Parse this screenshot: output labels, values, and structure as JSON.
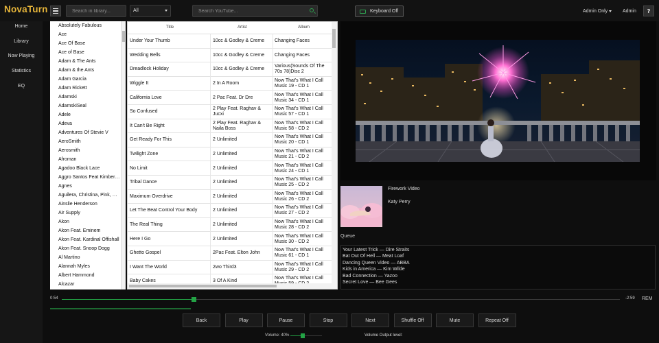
{
  "app": {
    "brand": "NovaTurn"
  },
  "topbar": {
    "library_search_placeholder": "Search in library...",
    "filter_value": "All",
    "youtube_search_placeholder": "Search YouTube...",
    "keyboard_label": "Keyboard Off",
    "admin_only_label": "Admin Only",
    "admin_label": "Admin",
    "help_label": "?"
  },
  "nav": [
    {
      "label": "Home"
    },
    {
      "label": "Library"
    },
    {
      "label": "Now Playing"
    },
    {
      "label": "Statistics"
    },
    {
      "label": "EQ"
    }
  ],
  "artists": [
    "Absolutely Fabulous",
    "Ace",
    "Ace Of Base",
    "Ace of Base",
    "Adam & The Ants",
    "Adam & the Ants",
    "Adam Garcia",
    "Adam Rickett",
    "Adamski",
    "AdamskiSeal",
    "Adele",
    "Adeva",
    "Adventures Of Stevie V",
    "AeroSmith",
    "Aerosmith",
    "Afroman",
    "Agadoo Black Lace",
    "Aggro Santos Feat Kimberly Wyatt",
    "Agnes",
    "Aguilera, Christina, Pink, Mya",
    "Ainslie Henderson",
    "Air Supply",
    "Akon",
    "Akon Feat. Eminem",
    "Akon Feat. Kardinal Offishall",
    "Akon Feat. Snoop Dogg",
    "Al Martino",
    "Alannah Myles",
    "Albert Hammond",
    "Alcazar"
  ],
  "tracks": {
    "columns": {
      "title": "Title",
      "artist": "Artist",
      "album": "Album"
    },
    "rows": [
      {
        "title": "Under Your Thumb",
        "artist": "10cc & Godley & Creme",
        "album": "Changing Faces"
      },
      {
        "title": "Wedding Bells",
        "artist": "10cc & Godley & Creme",
        "album": "Changing Faces"
      },
      {
        "title": "Dreadlock Holiday",
        "artist": "10cc & Godley & Creme",
        "album": "Various(Sounds Of The 70s 78)Disc 2"
      },
      {
        "title": "Wiggle It",
        "artist": "2 In A Room",
        "album": "Now That's What I Call Music 19 - CD 1"
      },
      {
        "title": "California Love",
        "artist": "2 Pac Feat. Dr Dre",
        "album": "Now That's What I Call Music 34 - CD 1"
      },
      {
        "title": "So Confused",
        "artist": "2 Play Feat. Raghav & Jucxi",
        "album": "Now That's What I Call Music 57 - CD 1"
      },
      {
        "title": "It Can't Be Right",
        "artist": "2 Play Feat. Raghav & Naila Boss",
        "album": "Now That's What I Call Music 58 - CD 2"
      },
      {
        "title": "Get Ready For This",
        "artist": "2 Unlimited",
        "album": "Now That's What I Call Music 20 - CD 1"
      },
      {
        "title": "Twilight Zone",
        "artist": "2 Unlimited",
        "album": "Now That's What I Call Music 21 - CD 2"
      },
      {
        "title": "No Limit",
        "artist": "2 Unlimited",
        "album": "Now That's What I Call Music 24 - CD 1"
      },
      {
        "title": "Tribal Dance",
        "artist": "2 Unlimited",
        "album": "Now That's What I Call Music 25 - CD 2"
      },
      {
        "title": "Maximum Overdrive",
        "artist": "2 Unlimited",
        "album": "Now That's What I Call Music 26 - CD 2"
      },
      {
        "title": "Let The Beat Control Your Body",
        "artist": "2 Unlimited",
        "album": "Now That's What I Call Music 27 - CD 2"
      },
      {
        "title": "The Real Thing",
        "artist": "2 Unlimited",
        "album": "Now That's What I Call Music 28 - CD 2"
      },
      {
        "title": "Here I Go",
        "artist": "2 Unlimited",
        "album": "Now That's What I Call Music 30 - CD 2"
      },
      {
        "title": "Ghetto Gospel",
        "artist": "2Pac Feat. Elton John",
        "album": "Now That's What I Call Music 61 - CD 1"
      },
      {
        "title": "I Want The World",
        "artist": "2wo Third3",
        "album": "Now That's What I Call Music 29 - CD 2"
      },
      {
        "title": "Baby Cakes",
        "artist": "3 Of A Kind",
        "album": "Now That's What I Call Music 59 - CD 2"
      }
    ]
  },
  "now_playing": {
    "title": "Firework Video",
    "artist": "Katy Perry"
  },
  "queue": {
    "label": "Queue",
    "items": [
      "Your Latest Trick — Dire Straits",
      "Bat Out Of Hell — Meat Loaf",
      "Dancing Queen Video — ABBA",
      "Kids in America — Kim Wilde",
      "Bad Connection — Yazoo",
      "Secret Love — Bee Gees"
    ]
  },
  "progress": {
    "elapsed": "0:54",
    "remaining": "-2:59",
    "rem_label": "REM",
    "fraction": 0.236
  },
  "controls": [
    {
      "label": "Back",
      "name": "back-button"
    },
    {
      "label": "Play",
      "name": "play-button"
    },
    {
      "label": "Pause",
      "name": "pause-button"
    },
    {
      "label": "Stop",
      "name": "stop-button"
    },
    {
      "label": "Next",
      "name": "next-button"
    },
    {
      "label": "Shuffle Off",
      "name": "shuffle-button"
    },
    {
      "label": "Mute",
      "name": "mute-button"
    },
    {
      "label": "Repeat Off",
      "name": "repeat-button"
    }
  ],
  "volume": {
    "label": "Volume: 40%",
    "percent": 40,
    "output_label": "Volume Output level:"
  },
  "colors": {
    "brand": "#e7b63a",
    "accent": "#23a345"
  }
}
